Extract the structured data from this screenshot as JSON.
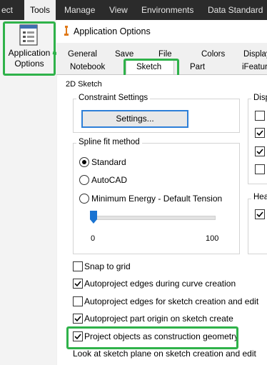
{
  "ribbon": {
    "tabs": [
      "ect",
      "Tools",
      "Manage",
      "View",
      "Environments",
      "Data Standard"
    ],
    "active_tab": "Tools"
  },
  "app_options_button": {
    "label": "Application Options",
    "icon": "options-dialog-icon"
  },
  "dialog": {
    "title": "Application Options",
    "tabs_row1": [
      "General",
      "Save",
      "File",
      "Colors",
      "Display"
    ],
    "tabs_row2": [
      "Notebook",
      "Sketch",
      "Part",
      "iFeature"
    ],
    "active_tab": "Sketch",
    "section_title": "2D Sketch",
    "constraint_settings": {
      "title": "Constraint Settings",
      "button": "Settings..."
    },
    "spline_fit": {
      "title": "Spline fit method",
      "options": [
        "Standard",
        "AutoCAD",
        "Minimum Energy - Default Tension"
      ],
      "selected": "Standard",
      "slider_min": "0",
      "slider_max": "100",
      "slider_value": 0
    },
    "display_group_title": "Disp",
    "heads_group_title": "Hea",
    "checkboxes": [
      {
        "label": "Snap to grid",
        "checked": false
      },
      {
        "label": "Autoproject edges during curve creation",
        "checked": true
      },
      {
        "label": "Autoproject edges for sketch creation and edit",
        "checked": false
      },
      {
        "label": "Autoproject part origin on sketch create",
        "checked": true
      },
      {
        "label": "Project objects as construction geometry",
        "checked": true
      },
      {
        "label": "Look at sketch plane on sketch creation and edit",
        "checked": false
      }
    ]
  },
  "highlight_color": "#2fb24a"
}
